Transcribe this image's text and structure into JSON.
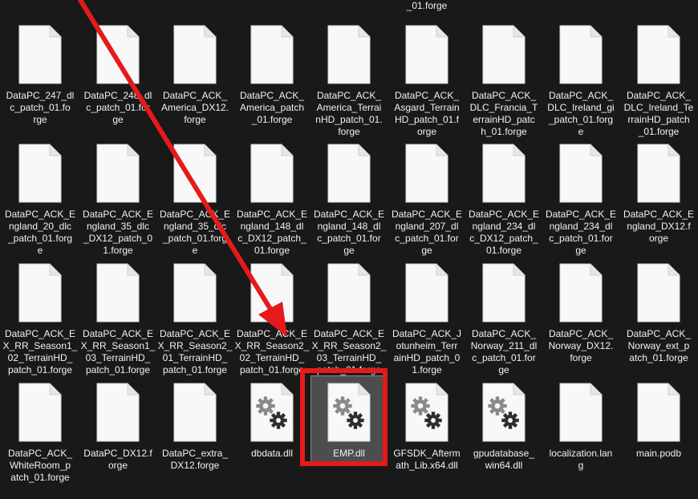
{
  "top_fragment": "_01.forge",
  "rows": [
    [
      {
        "label": "DataPC_247_dl\nc_patch_01.fo\nrge",
        "icon": "file-icon"
      },
      {
        "label": "DataPC_248_dl\nc_patch_01.for\nge",
        "icon": "file-icon"
      },
      {
        "label": "DataPC_ACK_\nAmerica_DX12.\nforge",
        "icon": "file-icon"
      },
      {
        "label": "DataPC_ACK_\nAmerica_patch\n_01.forge",
        "icon": "file-icon"
      },
      {
        "label": "DataPC_ACK_\nAmerica_Terrai\nnHD_patch_01.\nforge",
        "icon": "file-icon"
      },
      {
        "label": "DataPC_ACK_\nAsgard_Terrain\nHD_patch_01.f\norge",
        "icon": "file-icon"
      },
      {
        "label": "DataPC_ACK_\nDLC_Francia_T\nerrainHD_patc\nh_01.forge",
        "icon": "file-icon"
      },
      {
        "label": "DataPC_ACK_\nDLC_Ireland_gi\n_patch_01.forg\ne",
        "icon": "file-icon"
      },
      {
        "label": "DataPC_ACK_\nDLC_Ireland_Te\nrrainHD_patch\n_01.forge",
        "icon": "file-icon"
      }
    ],
    [
      {
        "label": "DataPC_ACK_E\nngland_20_dlc\n_patch_01.forg\ne",
        "icon": "file-icon"
      },
      {
        "label": "DataPC_ACK_E\nngland_35_dlc\n_DX12_patch_0\n1.forge",
        "icon": "file-icon"
      },
      {
        "label": "DataPC_ACK_E\nngland_35_dlc\n_patch_01.forg\ne",
        "icon": "file-icon"
      },
      {
        "label": "DataPC_ACK_E\nngland_148_dl\nc_DX12_patch_\n01.forge",
        "icon": "file-icon"
      },
      {
        "label": "DataPC_ACK_E\nngland_148_dl\nc_patch_01.for\nge",
        "icon": "file-icon"
      },
      {
        "label": "DataPC_ACK_E\nngland_207_dl\nc_patch_01.for\nge",
        "icon": "file-icon"
      },
      {
        "label": "DataPC_ACK_E\nngland_234_dl\nc_DX12_patch_\n01.forge",
        "icon": "file-icon"
      },
      {
        "label": "DataPC_ACK_E\nngland_234_dl\nc_patch_01.for\nge",
        "icon": "file-icon"
      },
      {
        "label": "DataPC_ACK_E\nngland_DX12.f\norge",
        "icon": "file-icon"
      }
    ],
    [
      {
        "label": "DataPC_ACK_E\nX_RR_Season1_\n02_TerrainHD_\npatch_01.forge",
        "icon": "file-icon"
      },
      {
        "label": "DataPC_ACK_E\nX_RR_Season1_\n03_TerrainHD_\npatch_01.forge",
        "icon": "file-icon"
      },
      {
        "label": "DataPC_ACK_E\nX_RR_Season2_\n01_TerrainHD_\npatch_01.forge",
        "icon": "file-icon"
      },
      {
        "label": "DataPC_ACK_E\nX_RR_Season2_\n02_TerrainHD_\npatch_01.forge",
        "icon": "file-icon"
      },
      {
        "label": "DataPC_ACK_E\nX_RR_Season2_\n03_TerrainHD_\npatch_01.forge",
        "icon": "file-icon"
      },
      {
        "label": "DataPC_ACK_J\notunheim_Terr\nainHD_patch_0\n1.forge",
        "icon": "file-icon"
      },
      {
        "label": "DataPC_ACK_\nNorway_211_dl\nc_patch_01.for\nge",
        "icon": "file-icon"
      },
      {
        "label": "DataPC_ACK_\nNorway_DX12.\nforge",
        "icon": "file-icon"
      },
      {
        "label": "DataPC_ACK_\nNorway_ext_p\natch_01.forge",
        "icon": "file-icon"
      }
    ],
    [
      {
        "label": "DataPC_ACK_\nWhiteRoom_p\natch_01.forge",
        "icon": "file-icon"
      },
      {
        "label": "DataPC_DX12.f\norge",
        "icon": "file-icon"
      },
      {
        "label": "DataPC_extra_\nDX12.forge",
        "icon": "file-icon"
      },
      {
        "label": "dbdata.dll",
        "icon": "dll-gear-icon"
      },
      {
        "label": "EMP.dll",
        "icon": "dll-gear-icon",
        "selected": true
      },
      {
        "label": "GFSDK_Afterm\nath_Lib.x64.dll",
        "icon": "dll-gear-icon"
      },
      {
        "label": "gpudatabase_\nwin64.dll",
        "icon": "dll-gear-icon"
      },
      {
        "label": "localization.lan\ng",
        "icon": "file-icon"
      },
      {
        "label": "main.podb",
        "icon": "file-icon"
      }
    ]
  ],
  "colors": {
    "background": "#191919",
    "annotation_red": "#e51a1a",
    "selection_bg": "#4d4d4d"
  }
}
